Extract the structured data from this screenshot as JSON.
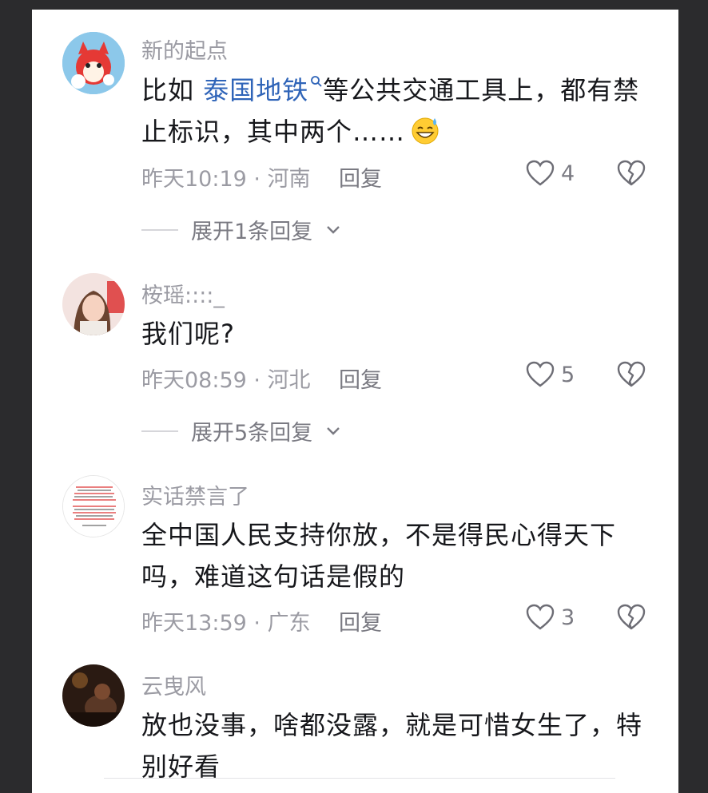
{
  "comments": [
    {
      "username": "新的起点",
      "text_before": "比如 ",
      "link": "泰国地铁",
      "text_after": "等公共交通工具上，都有禁止标识，其中两个……",
      "time": "昨天10:19",
      "location": "河南",
      "reply_label": "回复",
      "likes": "4",
      "expand": "展开1条回复"
    },
    {
      "username": "桉瑶::::_",
      "text": "我们呢?",
      "time": "昨天08:59",
      "location": "河北",
      "reply_label": "回复",
      "likes": "5",
      "expand": "展开5条回复"
    },
    {
      "username": "实话禁言了",
      "text": "全中国人民支持你放，不是得民心得天下吗，难道这句话是假的",
      "time": "昨天13:59",
      "location": "广东",
      "reply_label": "回复",
      "likes": "3"
    },
    {
      "username": "云曳风",
      "text": "放也没事，啥都没露，就是可惜女生了，特别好看"
    }
  ],
  "separator": " · ",
  "colors": {
    "link": "#2f64b8",
    "meta": "#9b9ba3",
    "text": "#16171b"
  }
}
